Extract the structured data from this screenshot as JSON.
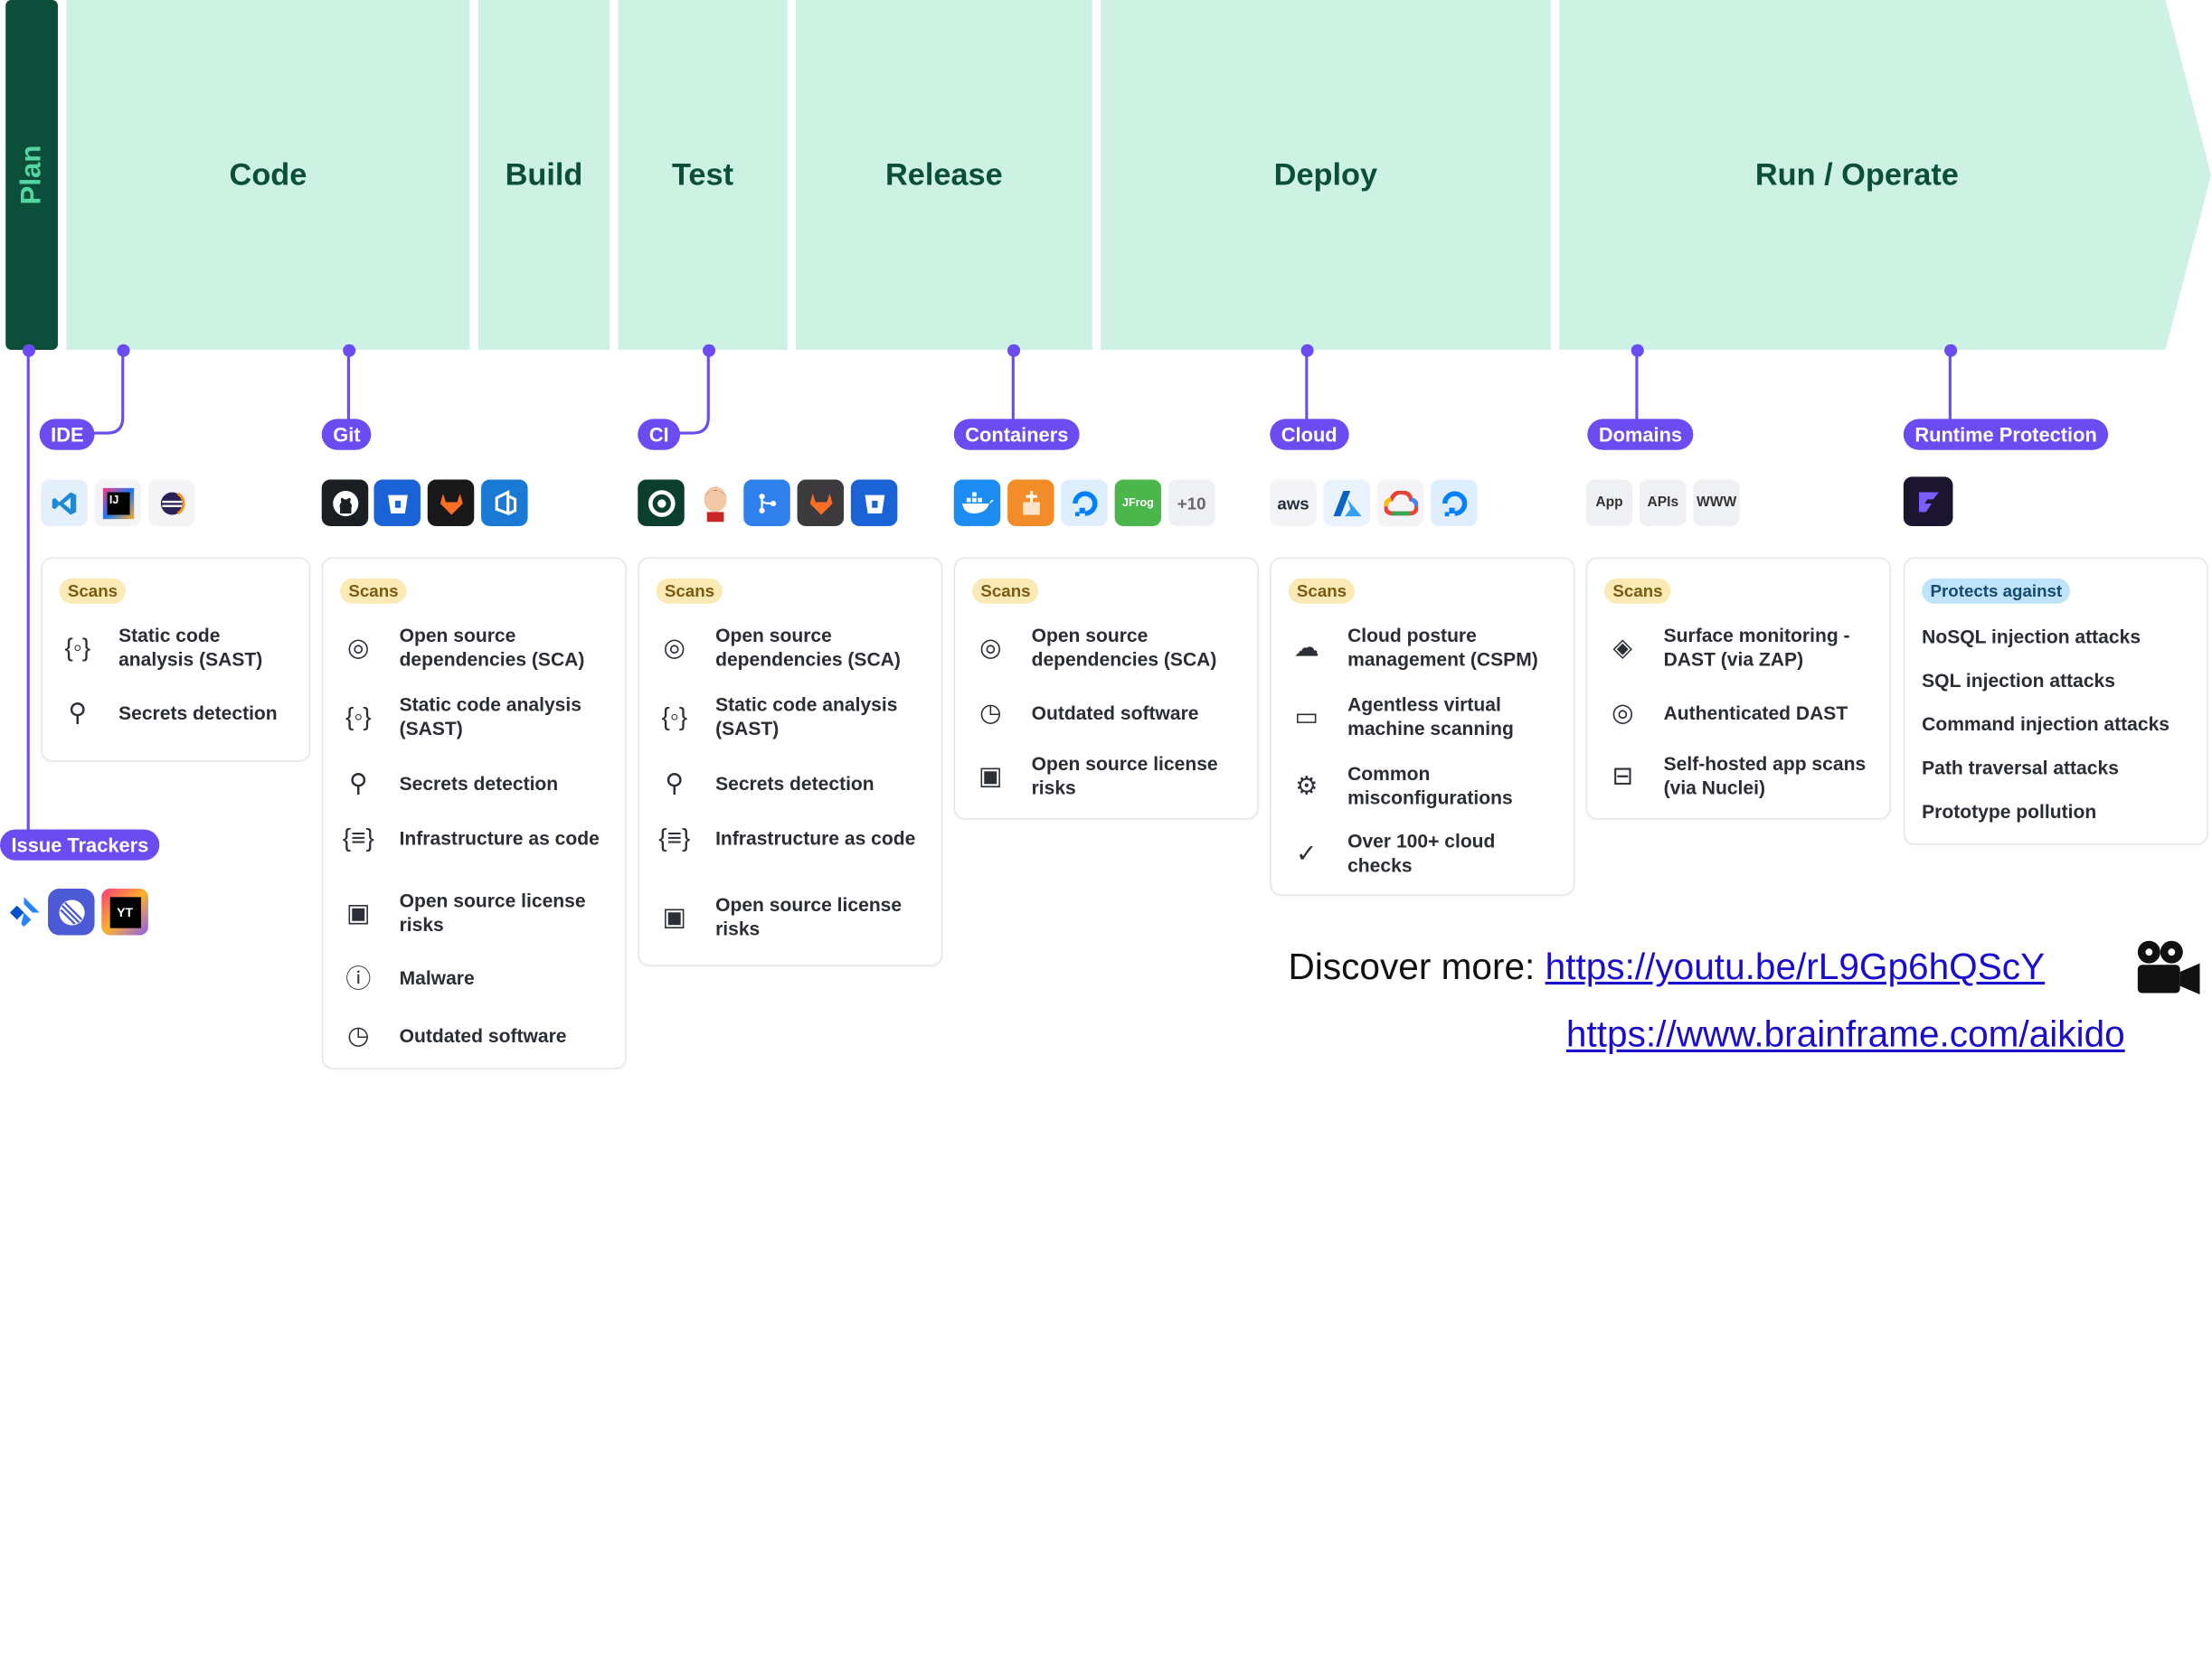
{
  "phases": {
    "plan": "Plan",
    "code": "Code",
    "build": "Build",
    "test": "Test",
    "release": "Release",
    "deploy": "Deploy",
    "run": "Run / Operate"
  },
  "colors": {
    "phase_bg": "#cdf1e3",
    "plan_bg": "#0b4f3a",
    "accent": "#6a4cf0",
    "scans_badge": "#fbeab5",
    "protects_badge": "#bfe3f8"
  },
  "pills": {
    "ide": "IDE",
    "git": "Git",
    "ci": "CI",
    "containers": "Containers",
    "cloud": "Cloud",
    "domains": "Domains",
    "runtime": "Runtime Protection",
    "issue_trackers": "Issue Trackers"
  },
  "icons": {
    "ide": [
      "vscode-icon",
      "intellij-icon",
      "eclipse-icon"
    ],
    "git": [
      "github-icon",
      "bitbucket-icon",
      "gitlab-icon",
      "azure-devops-icon"
    ],
    "ci": [
      "circleci-icon",
      "jenkins-icon",
      "git-pipeline-icon",
      "gitlab-ci-icon",
      "bitbucket-pipelines-icon"
    ],
    "containers": [
      "docker-icon",
      "container-registry-icon",
      "digitalocean-icon",
      "jfrog-icon"
    ],
    "containers_more": "+10",
    "cloud": [
      "aws-icon",
      "azure-icon",
      "google-cloud-icon",
      "digitalocean-cloud-icon"
    ],
    "cloud_aws_text": "aws",
    "domains": [
      "App",
      "APIs",
      "WWW"
    ],
    "runtime": [
      "aikido-zen-icon"
    ],
    "issue_trackers": [
      "jira-icon",
      "linear-icon",
      "youtrack-icon"
    ],
    "jfrog_text": "JFrog",
    "youtrack_text": "YT"
  },
  "scans_label": "Scans",
  "protects_label": "Protects against",
  "cards": {
    "ide": [
      "Static code analysis (SAST)",
      "Secrets detection"
    ],
    "git": [
      "Open source dependencies (SCA)",
      "Static code analysis (SAST)",
      "Secrets detection",
      "Infrastructure as code",
      "Open source license risks",
      "Malware",
      "Outdated software"
    ],
    "ci": [
      "Open source dependencies (SCA)",
      "Static code analysis (SAST)",
      "Secrets detection",
      "Infrastructure as code",
      "Open source license risks"
    ],
    "containers": [
      "Open source dependencies (SCA)",
      "Outdated software",
      "Open source license risks"
    ],
    "cloud": [
      "Cloud posture management (CSPM)",
      "Agentless virtual machine scanning",
      "Common misconfigurations",
      "Over 100+ cloud checks"
    ],
    "domains": [
      "Surface monitoring - DAST (via ZAP)",
      "Authenticated DAST",
      "Self-hosted app scans (via Nuclei)"
    ],
    "runtime": [
      "NoSQL injection attacks",
      "SQL injection attacks",
      "Command injection attacks",
      "Path traversal attacks",
      "Prototype pollution"
    ]
  },
  "footer": {
    "discover_label": "Discover more:",
    "youtube_link": "https://youtu.be/rL9Gp6hQScY",
    "brainframe_link": "https://www.brainframe.com/aikido",
    "camera_icon": "movie-camera-icon"
  }
}
